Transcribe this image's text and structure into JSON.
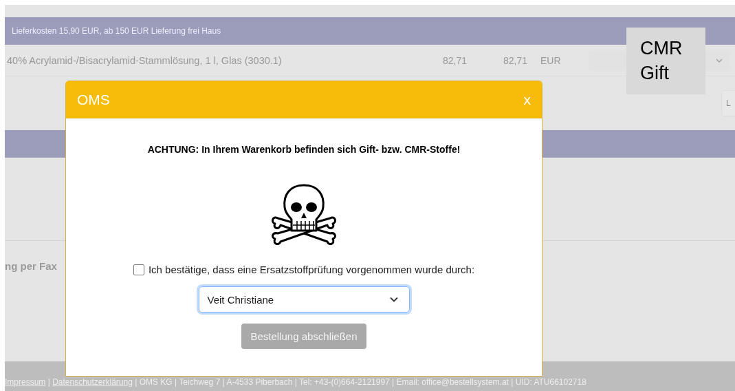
{
  "shipping_bar": {
    "text": "Lieferkosten 15,90 EUR, ab 150 EUR Lieferung frei Haus"
  },
  "product_row": {
    "name": "40% Acrylamid-/Bisacrylamid-Stammlösung, 1 l, Glas (3030.1)",
    "unit_price": "82,71",
    "total": "82,71",
    "currency": "EUR"
  },
  "side_button": {
    "label": "L"
  },
  "fax_heading": "ng per Fax",
  "note": {
    "lines": [
      "CMR",
      "Gift"
    ]
  },
  "dialog": {
    "title": "OMS",
    "close": "x",
    "warning": "ACHTUNG: In Ihrem Warenkorb befinden sich Gift- bzw. CMR-Stoffe!",
    "confirm": {
      "label": "Ich bestätige, dass eine Ersatzstoffprüfung vorgenommen wurde durch:",
      "checked": false
    },
    "select": {
      "value": "Veit Christiane"
    },
    "submit": {
      "label": "Bestellung abschließen",
      "disabled": true
    }
  },
  "footer": {
    "parts": [
      {
        "kind": "link",
        "text": "Impressum"
      },
      {
        "kind": "text",
        "text": " | "
      },
      {
        "kind": "link",
        "text": "Datenschutzerklärung"
      },
      {
        "kind": "text",
        "text": " | OMS KG | Teichweg 7 | A-4533 Piberbach | Tel: +43-(0)664-2121997 | Email: office@bestellsystem.at | UID: ATU66102718"
      }
    ]
  }
}
